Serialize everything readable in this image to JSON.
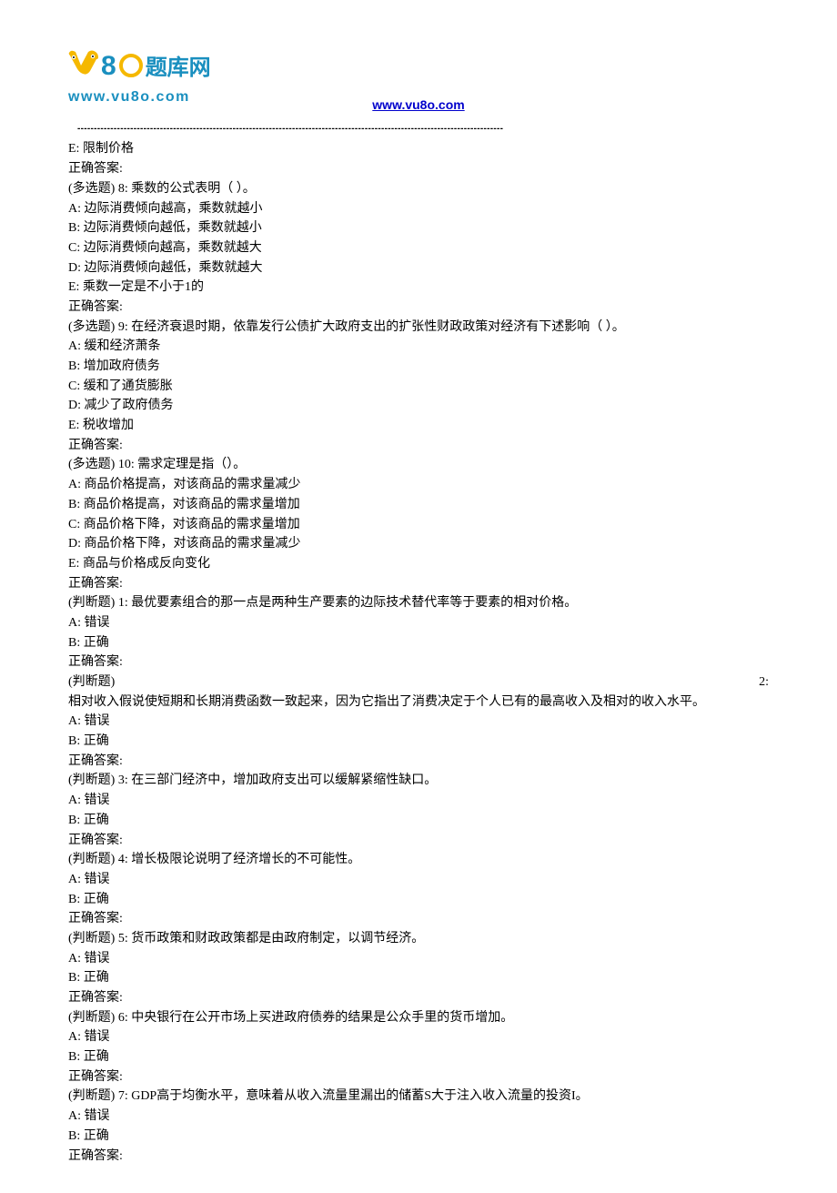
{
  "header": {
    "logo_cn": "题库网",
    "logo_url_text": "www.vu8o.com",
    "link_text": "www.vu8o.com"
  },
  "separator_dashes": "---------------------------------------------------------------------------------------------------------------------------------",
  "lines": [
    "E: 限制价格",
    "正确答案:",
    "(多选题) 8: 乘数的公式表明（ ）。",
    "A: 边际消费倾向越高，乘数就越小",
    "B: 边际消费倾向越低，乘数就越小",
    "C: 边际消费倾向越高，乘数就越大",
    "D: 边际消费倾向越低，乘数就越大",
    "E: 乘数一定是不小于1的",
    "正确答案:",
    "(多选题) 9: 在经济衰退时期，依靠发行公债扩大政府支出的扩张性财政政策对经济有下述影响（ ）。",
    "A: 缓和经济萧条",
    "B: 增加政府债务",
    "C: 缓和了通货膨胀",
    "D: 减少了政府债务",
    "E: 税收增加",
    "正确答案:",
    "(多选题) 10: 需求定理是指（）。",
    "A: 商品价格提高，对该商品的需求量减少",
    "B: 商品价格提高，对该商品的需求量增加",
    "C: 商品价格下降，对该商品的需求量增加",
    "D: 商品价格下降，对该商品的需求量减少",
    "E: 商品与价格成反向变化",
    "正确答案:",
    "(判断题) 1: 最优要素组合的那一点是两种生产要素的边际技术替代率等于要素的相对价格。",
    "A: 错误",
    "B: 正确",
    "正确答案:",
    {
      "justify_left": "(判断题)",
      "justify_right": "2:"
    },
    "相对收入假说使短期和长期消费函数一致起来，因为它指出了消费决定于个人已有的最高收入及相对的收入水平。",
    "A: 错误",
    "B: 正确",
    "正确答案:",
    "(判断题) 3: 在三部门经济中，增加政府支出可以缓解紧缩性缺口。",
    "A: 错误",
    "B: 正确",
    "正确答案:",
    "(判断题) 4: 增长极限论说明了经济增长的不可能性。",
    "A: 错误",
    "B: 正确",
    "正确答案:",
    "(判断题) 5: 货币政策和财政政策都是由政府制定，以调节经济。",
    "A: 错误",
    "B: 正确",
    "正确答案:",
    "(判断题) 6: 中央银行在公开市场上买进政府债券的结果是公众手里的货币增加。",
    "A: 错误",
    "B: 正确",
    "正确答案:",
    "(判断题) 7: GDP高于均衡水平，意味着从收入流量里漏出的储蓄S大于注入收入流量的投资I。",
    "A: 错误",
    "B: 正确",
    "正确答案:"
  ]
}
